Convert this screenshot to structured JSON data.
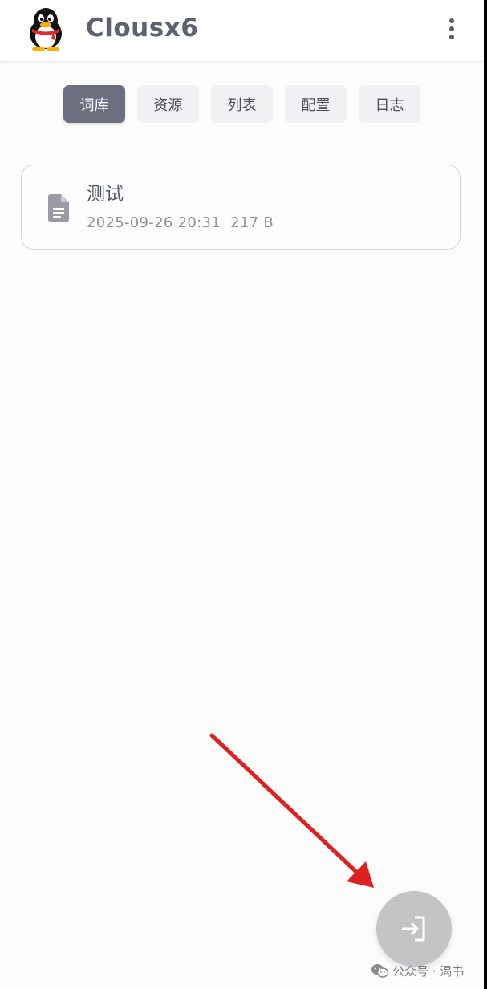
{
  "header": {
    "title": "Clousx6",
    "avatar_icon": "qq-penguin-icon",
    "menu_icon": "more-vert-icon"
  },
  "tabs": [
    {
      "label": "词库",
      "active": true
    },
    {
      "label": "资源",
      "active": false
    },
    {
      "label": "列表",
      "active": false
    },
    {
      "label": "配置",
      "active": false
    },
    {
      "label": "日志",
      "active": false
    }
  ],
  "files": [
    {
      "icon": "document-icon",
      "name": "测试",
      "date": "2025-09-26 20:31",
      "size": "217 B"
    }
  ],
  "fab": {
    "icon": "login-icon"
  },
  "annotation": {
    "type": "red-arrow",
    "color": "#e02020"
  },
  "watermark": {
    "icon": "wechat-icon",
    "text": "公众号 · 渴书"
  },
  "colors": {
    "accent": "#6b6f80",
    "title": "#5e6170",
    "tab_bg": "#f1f0f3",
    "fab_bg": "#c4c3c6"
  }
}
